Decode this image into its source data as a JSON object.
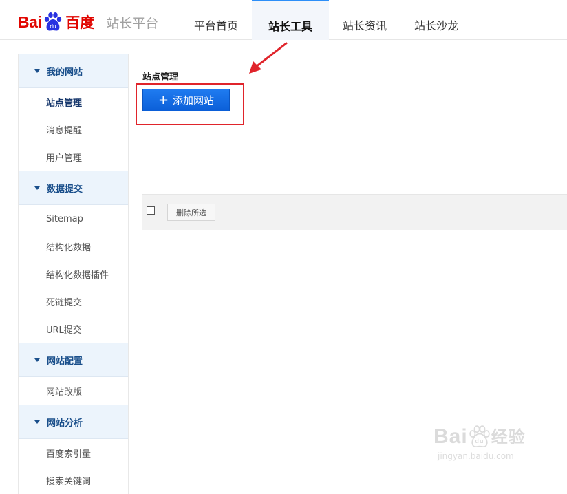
{
  "brand": {
    "logo_bai": "Bai",
    "logo_du": "du",
    "logo_cn": "百度",
    "platform": "站长平台",
    "logo_color": "#e10601"
  },
  "nav": {
    "items": [
      {
        "label": "平台首页",
        "active": false
      },
      {
        "label": "站长工具",
        "active": true
      },
      {
        "label": "站长资讯",
        "active": false
      },
      {
        "label": "站长沙龙",
        "active": false
      }
    ]
  },
  "sidebar": {
    "groups": [
      {
        "label": "我的网站",
        "items": [
          "站点管理",
          "消息提醒",
          "用户管理"
        ]
      },
      {
        "label": "数据提交",
        "items": [
          "Sitemap",
          "结构化数据",
          "结构化数据插件",
          "死链提交",
          "URL提交"
        ]
      },
      {
        "label": "网站配置",
        "items": [
          "网站改版"
        ]
      },
      {
        "label": "网站分析",
        "items": [
          "百度索引量",
          "搜索关键词"
        ]
      }
    ],
    "active_item": "站点管理"
  },
  "main": {
    "section_title": "站点管理",
    "add_button_label": "添加网站",
    "add_button_icon": "plus-icon",
    "delete_selected_label": "删除所选"
  },
  "annotation": {
    "highlight_color": "#e0242b"
  },
  "watermark": {
    "main": "Bai",
    "du": "du",
    "cn": "经验",
    "sub": "jingyan.baidu.com"
  },
  "colors": {
    "accent": "#1f7bf0",
    "sidebar_group_bg": "#ecf4fc",
    "sidebar_group_text": "#1a4f8b"
  }
}
